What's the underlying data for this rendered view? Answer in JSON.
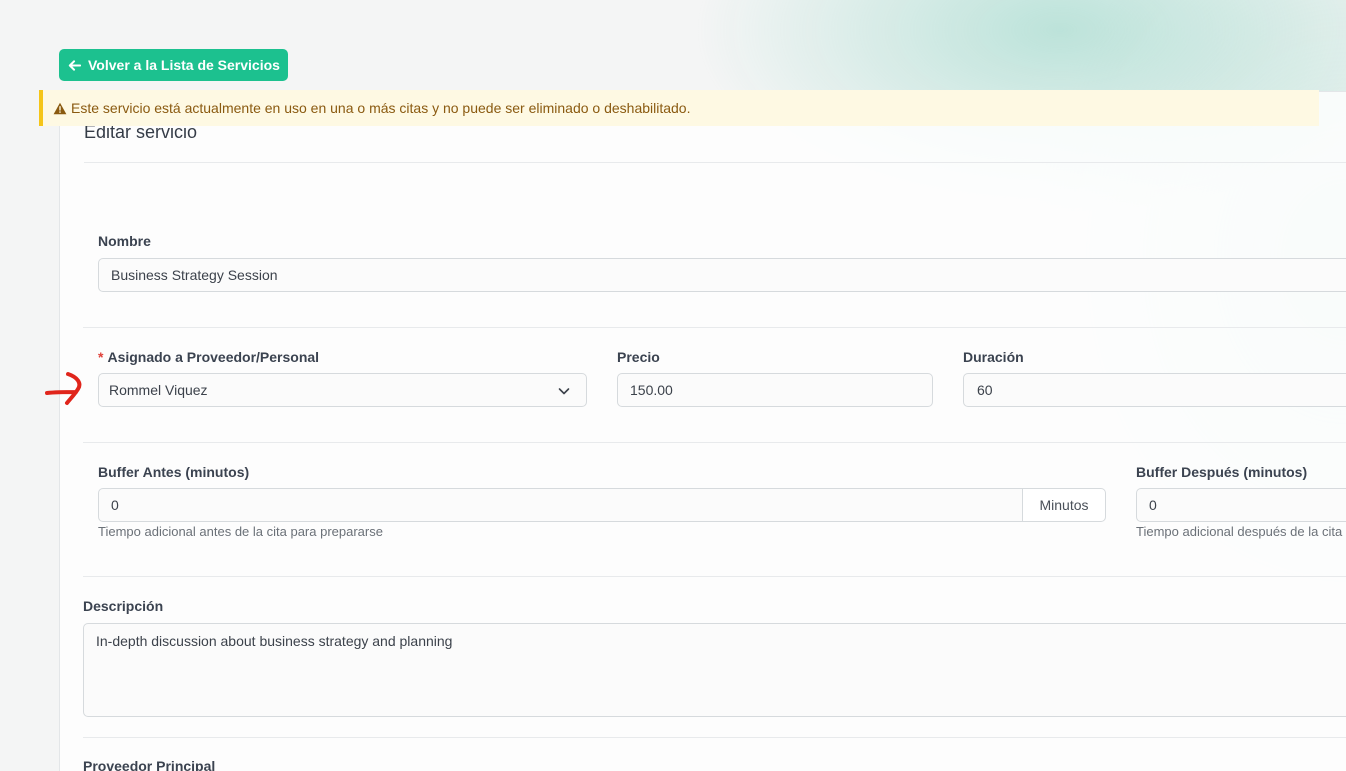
{
  "back_button": {
    "label": "Volver a la Lista de Servicios",
    "icon": "arrow-left-icon"
  },
  "card": {
    "title": "Editar servicio"
  },
  "alert": {
    "icon": "warning-icon",
    "text": "Este servicio está actualmente en uso en una o más citas y no puede ser eliminado o deshabilitado.",
    "color": "#8a5a10",
    "background": "#fef9e3",
    "border": "#f5c518"
  },
  "form": {
    "name": {
      "label": "Nombre",
      "value": "Business Strategy Session"
    },
    "provider": {
      "required_mark": "*",
      "label": "Asignado a Proveedor/Personal",
      "value": "Rommel Viquez"
    },
    "price": {
      "label": "Precio",
      "value": "150.00"
    },
    "duration": {
      "label": "Duración",
      "value": "60"
    },
    "buffer_before": {
      "label": "Buffer Antes (minutos)",
      "value": "0",
      "unit": "Minutos",
      "help": "Tiempo adicional antes de la cita para prepararse"
    },
    "buffer_after": {
      "label": "Buffer Después (minutos)",
      "value": "0",
      "help": "Tiempo adicional después de la cita"
    },
    "description": {
      "label": "Descripción",
      "value": "In-depth discussion about business strategy and planning"
    },
    "main_provider": {
      "label": "Proveedor Principal"
    }
  },
  "colors": {
    "accent": "#1cc18f",
    "annotation": "#e0251b"
  }
}
